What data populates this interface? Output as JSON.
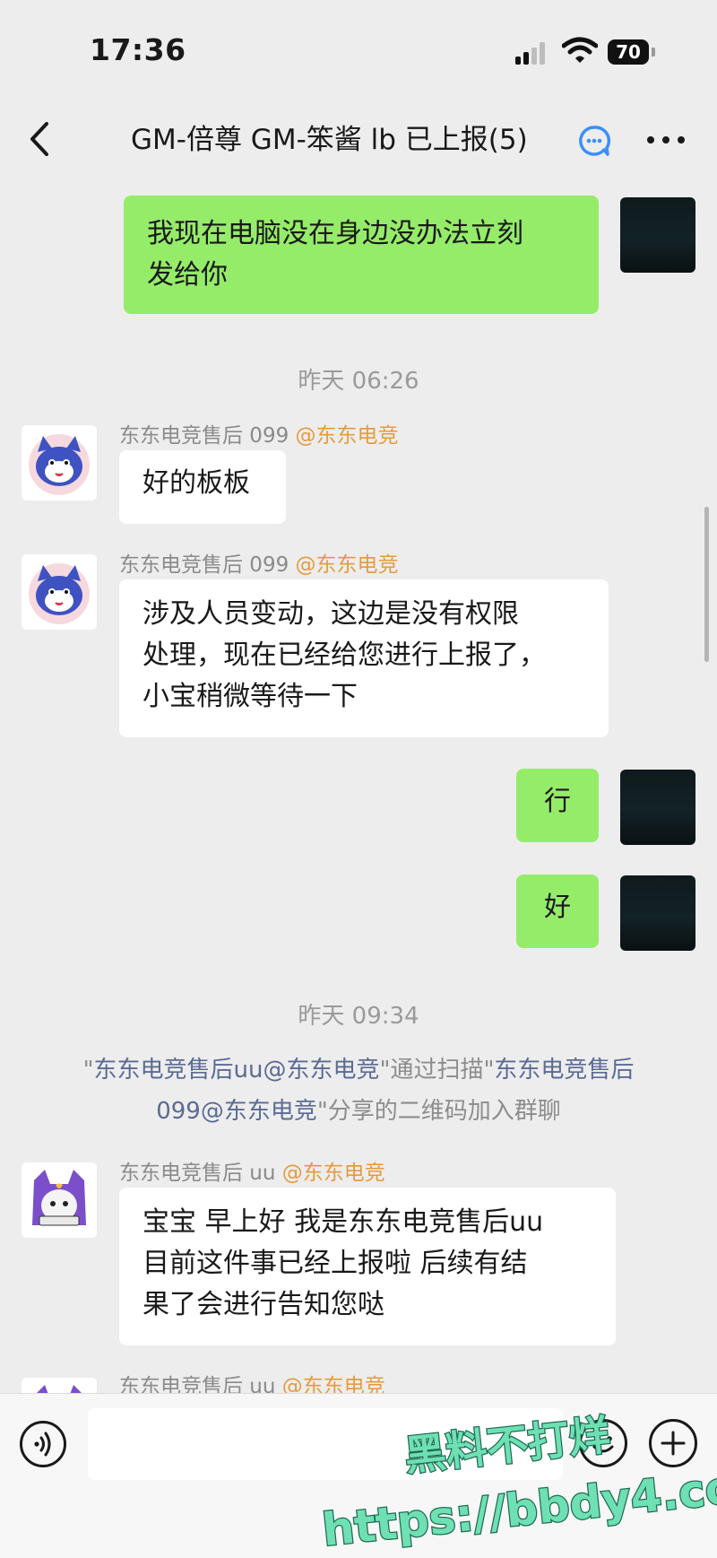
{
  "status_bar": {
    "time": "17:36",
    "battery": "70"
  },
  "header": {
    "title": "GM-倍尊 GM-笨酱  lb 已上报(5)"
  },
  "messages": {
    "m1": {
      "lines": [
        "我现在电脑没在身边没办法立刻",
        "发给你"
      ]
    },
    "ts1": "昨天 06:26",
    "m2": {
      "sender": "东东电竞售后 099",
      "mention": "@东东电竞",
      "lines": [
        "好的板板"
      ]
    },
    "m3": {
      "sender": "东东电竞售后 099",
      "mention": "@东东电竞",
      "lines": [
        "涉及人员变动，这边是没有权限",
        "处理，现在已经给您进行上报了，",
        "小宝稍微等待一下"
      ]
    },
    "m4": {
      "lines": [
        "行"
      ]
    },
    "m5": {
      "lines": [
        "好"
      ]
    },
    "ts2": "昨天 09:34",
    "system": {
      "q1": "\"",
      "name1": "东东电竞售后uu@东东电竞",
      "t1": "\"通过扫描\"",
      "name2a": "东东电竞售后",
      "name2b": "099@东东电竞",
      "t2": "\"分享的二维码加入群聊"
    },
    "m6": {
      "sender": "东东电竞售后 uu",
      "mention": "@东东电竞",
      "lines": [
        "宝宝 早上好 我是东东电竞售后uu",
        "目前这件事已经上报啦 后续有结",
        "果了会进行告知您哒"
      ]
    },
    "m7": {
      "sender": "东东电竞售后 uu",
      "mention": "@东东电竞"
    }
  },
  "watermark": {
    "line1": "黑料不打烊",
    "line2": "https://bbdy4.com"
  },
  "icons": [
    "back-icon",
    "ai-icon",
    "more-icon",
    "voice-icon",
    "emoji-icon",
    "plus-icon"
  ],
  "colors": {
    "self_bubble": "#95ec69",
    "other_bubble": "#ffffff",
    "mention": "#e69a3c",
    "background": "#ededed",
    "watermark": "#6fe0b3"
  }
}
